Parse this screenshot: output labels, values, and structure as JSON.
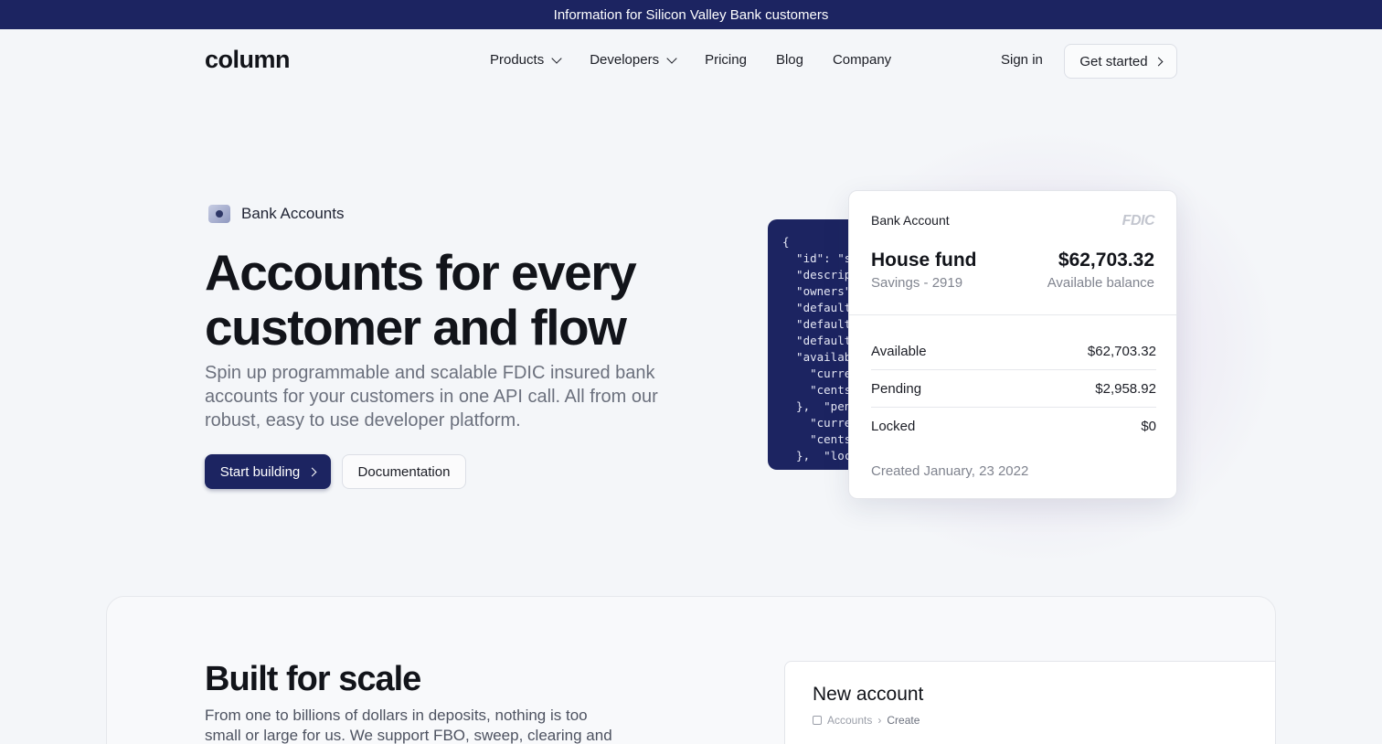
{
  "banner": {
    "text": "Information for Silicon Valley Bank customers"
  },
  "nav": {
    "logo": "column",
    "links": [
      {
        "label": "Products",
        "icon": "chevron-down-icon"
      },
      {
        "label": "Developers",
        "icon": "chevron-down-icon"
      },
      {
        "label": "Pricing"
      },
      {
        "label": "Blog"
      },
      {
        "label": "Company"
      }
    ],
    "signin": "Sign in",
    "get_started": "Get started"
  },
  "hero": {
    "badge": "Bank Accounts",
    "title_line1": "Accounts for every",
    "title_line2": "customer and flow",
    "subtitle": "Spin up programmable and scalable FDIC insured bank accounts for your customers in one API call. All from our robust, easy to use developer platform.",
    "primary_button": "Start building",
    "secondary_button": "Documentation"
  },
  "code_snippet": "{\n  \"id\": \"s\n  \"descrip\n  \"owners\"\n  \"default\n  \"default\n  \"default\n  \"availab\n    \"curre\n    \"cents\n  },  \"pen\n    \"curre\n    \"cents\n  },  \"loc",
  "account_card": {
    "label": "Bank Account",
    "fdic": "FDIC",
    "name": "House fund",
    "type": "Savings - 2919",
    "balance": "$62,703.32",
    "balance_label": "Available balance",
    "rows": [
      {
        "label": "Available",
        "value": "$62,703.32"
      },
      {
        "label": "Pending",
        "value": "$2,958.92"
      },
      {
        "label": "Locked",
        "value": "$0"
      }
    ],
    "created": "Created January, 23 2022"
  },
  "scale_section": {
    "title": "Built for scale",
    "subtitle": "From one to billions of dollars in deposits, nothing is too small or large for us. We support FBO, sweep, clearing and",
    "new_account": {
      "title": "New account",
      "crumb_parent": "Accounts",
      "crumb_current": "Create"
    }
  },
  "colors": {
    "brand": "#1c2461",
    "background": "#f4f6f9"
  }
}
